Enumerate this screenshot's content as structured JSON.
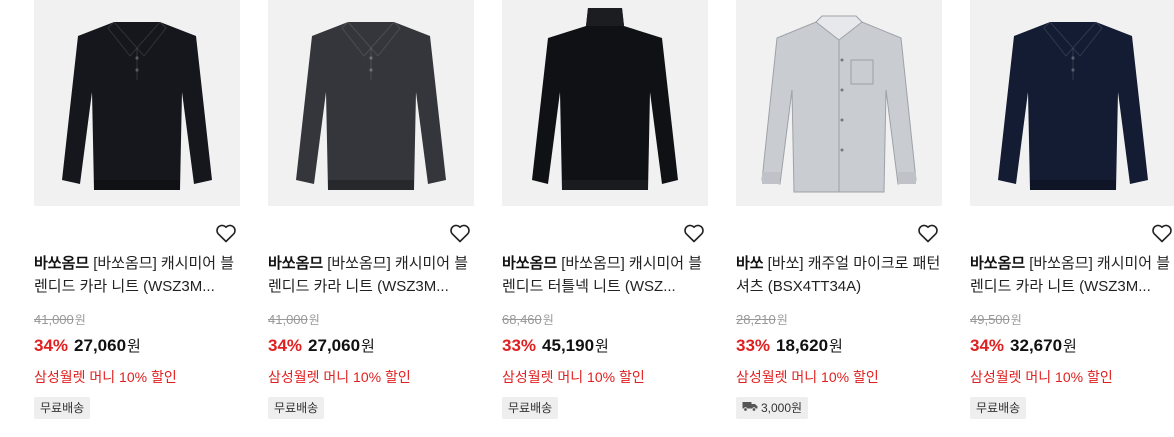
{
  "products": [
    {
      "brand": "바쏘옴므",
      "name": "[바쏘옴므] 캐시미어 블렌디드 카라 니트 (WSZ3M...",
      "original_price": "41,000",
      "discount_rate": "34%",
      "sale_price": "27,060",
      "currency": "원",
      "promo": "삼성월렛 머니 10% 할인",
      "shipping": "무료배송",
      "shipping_icon": "",
      "image": {
        "type": "polo",
        "color": "#15171c"
      }
    },
    {
      "brand": "바쏘옴므",
      "name": "[바쏘옴므] 캐시미어 블렌디드 카라 니트 (WSZ3M...",
      "original_price": "41,000",
      "discount_rate": "34%",
      "sale_price": "27,060",
      "currency": "원",
      "promo": "삼성월렛 머니 10% 할인",
      "shipping": "무료배송",
      "shipping_icon": "",
      "image": {
        "type": "polo",
        "color": "#34363b"
      }
    },
    {
      "brand": "바쏘옴므",
      "name": "[바쏘옴므] 캐시미어 블렌디드 터틀넥 니트 (WSZ...",
      "original_price": "68,460",
      "discount_rate": "33%",
      "sale_price": "45,190",
      "currency": "원",
      "promo": "삼성월렛 머니 10% 할인",
      "shipping": "무료배송",
      "shipping_icon": "",
      "image": {
        "type": "turtleneck",
        "color": "#101114"
      }
    },
    {
      "brand": "바쏘",
      "name": "[바쏘] 캐주얼 마이크로 패턴 셔츠 (BSX4TT34A)",
      "original_price": "28,210",
      "discount_rate": "33%",
      "sale_price": "18,620",
      "currency": "원",
      "promo": "삼성월렛 머니 10% 할인",
      "shipping": "3,000원",
      "shipping_icon": "truck-icon",
      "image": {
        "type": "shirt",
        "color": "#c9ccd1"
      }
    },
    {
      "brand": "바쏘옴므",
      "name": "[바쏘옴므] 캐시미어 블렌디드 카라 니트 (WSZ3M...",
      "original_price": "49,500",
      "discount_rate": "34%",
      "sale_price": "32,670",
      "currency": "원",
      "promo": "삼성월렛 머니 10% 할인",
      "shipping": "무료배송",
      "shipping_icon": "",
      "image": {
        "type": "polo",
        "color": "#141c33"
      }
    }
  ],
  "colors": {
    "discount": "#e02020",
    "promo": "#e02020",
    "thumb_bg": "#f1f1f1"
  },
  "icons": {
    "wishlist": "heart-outline-icon",
    "shipping_paid": "truck-icon"
  }
}
